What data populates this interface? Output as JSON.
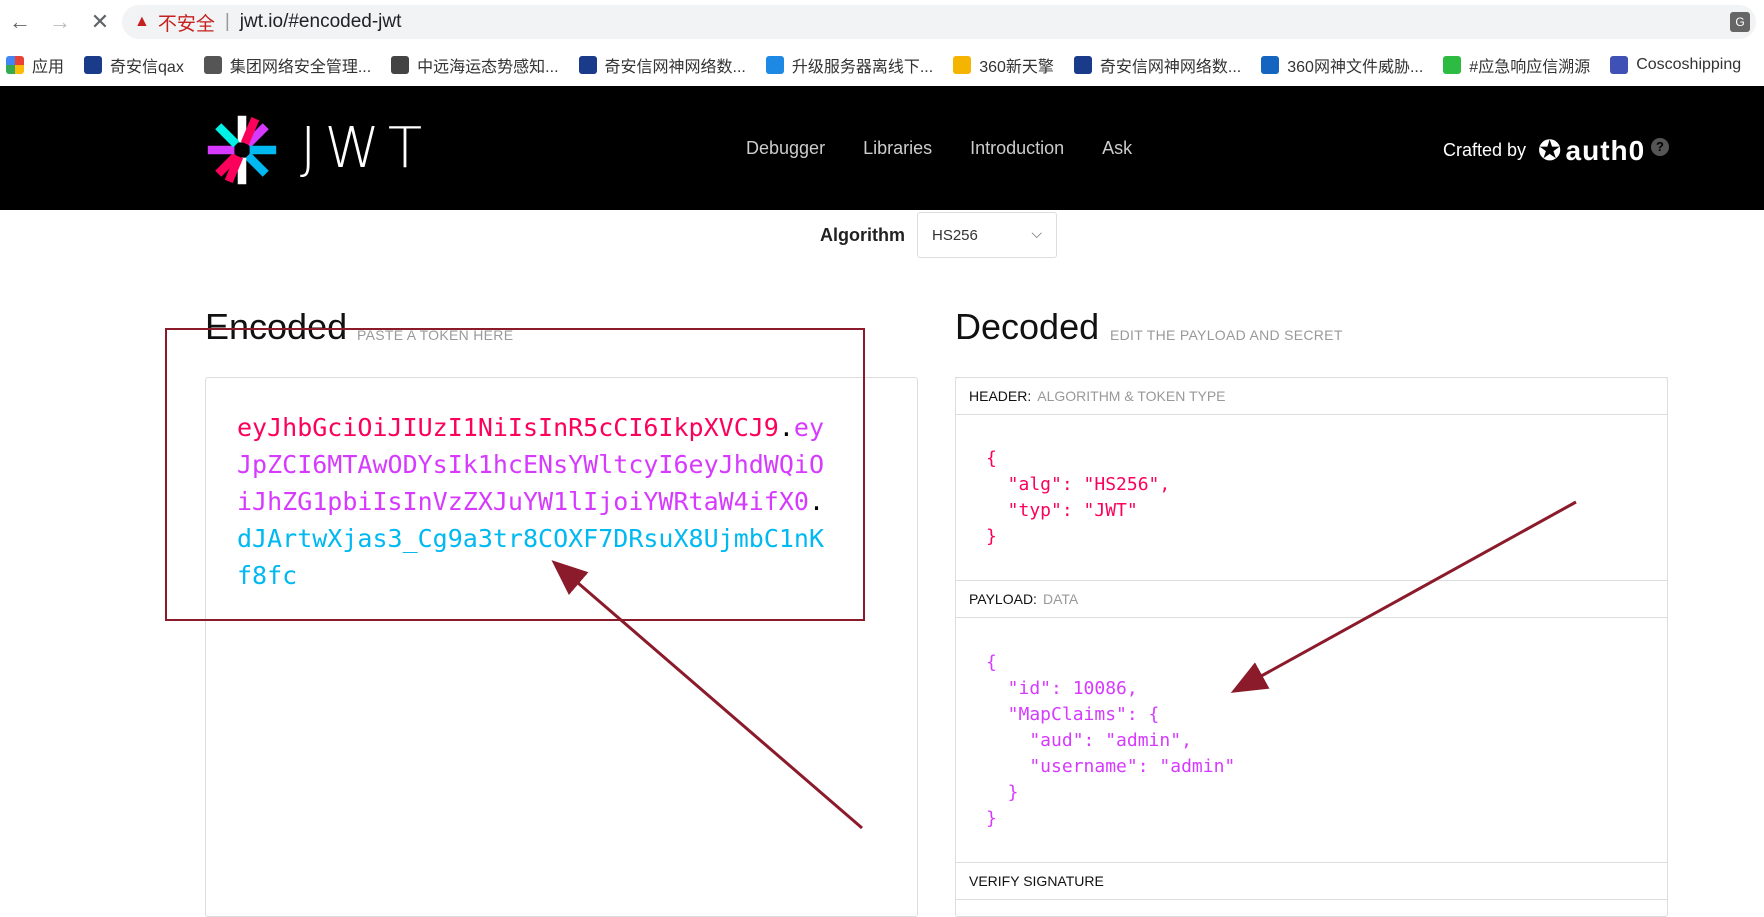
{
  "browser": {
    "security_label": "不安全",
    "separator": "|",
    "url": "jwt.io/#encoded-jwt",
    "translate_glyph": "G"
  },
  "bookmarks": [
    {
      "label": "应用",
      "color": "#e94235"
    },
    {
      "label": "奇安信qax",
      "color": "#1a3a8a"
    },
    {
      "label": "集团网络安全管理...",
      "color": "#555555"
    },
    {
      "label": "中远海运态势感知...",
      "color": "#444444"
    },
    {
      "label": "奇安信网神网络数...",
      "color": "#1a3a8a"
    },
    {
      "label": "升级服务器离线下...",
      "color": "#1e88e5"
    },
    {
      "label": "360新天擎",
      "color": "#f5b400"
    },
    {
      "label": "奇安信网神网络数...",
      "color": "#1a3a8a"
    },
    {
      "label": "360网神文件威胁...",
      "color": "#1565c0"
    },
    {
      "label": "#应急响应信溯源",
      "color": "#2dbb42"
    },
    {
      "label": "Coscoshipping",
      "color": "#3f51b5"
    }
  ],
  "jwt_header": {
    "logo_text": "JWT",
    "nav": [
      "Debugger",
      "Libraries",
      "Introduction",
      "Ask"
    ],
    "crafted_by": "Crafted by",
    "brand": "auth0",
    "help": "?"
  },
  "algorithm": {
    "label": "Algorithm",
    "value": "HS256",
    "chevron": "⌵"
  },
  "encoded": {
    "title": "Encoded",
    "subtitle": "PASTE A TOKEN HERE",
    "header_part": "eyJhbGciOiJIUzI1NiIsInR5cCI6IkpXVCJ9",
    "payload_part": "eyJpZCI6MTAwODYsIk1hcENsYWltcyI6eyJhdWQiOiJhZG1pbiIsInVzZXJuYW1lIjoiYWRtaW4ifX0",
    "signature_part": "dJArtwXjas3_Cg9a3tr8COXF7DRsuX8UjmbC1nKf8fc",
    "dot": "."
  },
  "decoded": {
    "title": "Decoded",
    "subtitle": "EDIT THE PAYLOAD AND SECRET",
    "header_section": {
      "key": "HEADER:",
      "value": "ALGORITHM & TOKEN TYPE"
    },
    "header_json": "{\n  \"alg\": \"HS256\",\n  \"typ\": \"JWT\"\n}",
    "payload_section": {
      "key": "PAYLOAD:",
      "value": "DATA"
    },
    "payload_json": "{\n  \"id\": 10086,\n  \"MapClaims\": {\n    \"aud\": \"admin\",\n    \"username\": \"admin\"\n  }\n}",
    "verify_section": {
      "key": "VERIFY SIGNATURE",
      "value": ""
    }
  },
  "colors": {
    "annotation": "#8b1a2b",
    "token_header": "#fb015b",
    "token_payload": "#d63aff",
    "token_signature": "#00b9f1"
  }
}
